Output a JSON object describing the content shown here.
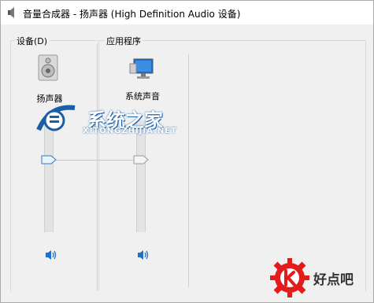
{
  "window": {
    "title": "音量合成器 - 扬声器 (High Definition Audio 设备)"
  },
  "devices_group": {
    "label": "设备(D)",
    "device": {
      "label": "扬声器",
      "icon": "speaker-device-icon",
      "volume_percent": 63,
      "mute_icon": "speaker-volume-icon"
    }
  },
  "apps_group": {
    "label": "应用程序",
    "app": {
      "label": "系统声音",
      "icon": "system-sounds-icon",
      "volume_percent": 63,
      "mute_icon": "speaker-volume-icon"
    }
  },
  "watermark": {
    "title": "系统之家",
    "url": "XITONGZHIJIA.NET",
    "brand": "好点吧"
  },
  "colors": {
    "accent": "#1a73c8",
    "brand_red": "#e31b1b"
  }
}
